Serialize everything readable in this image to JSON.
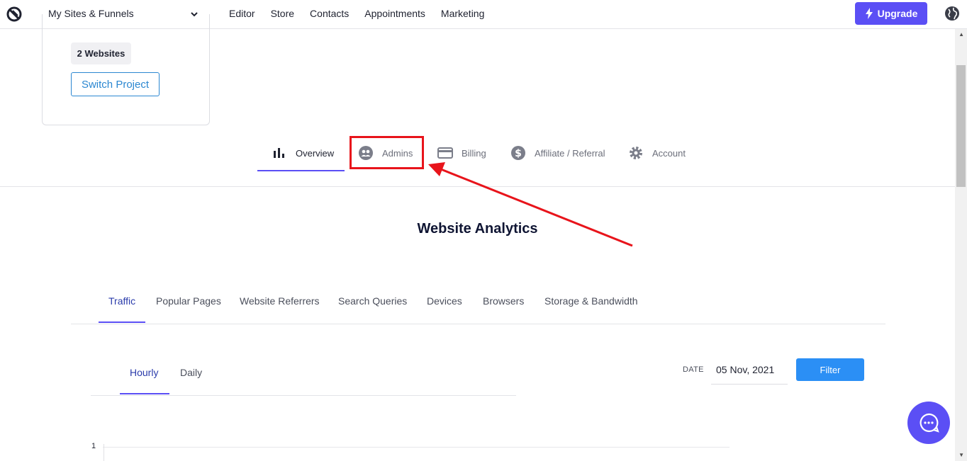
{
  "topnav": {
    "site_select": "My Sites & Funnels",
    "links": [
      "Editor",
      "Store",
      "Contacts",
      "Appointments",
      "Marketing"
    ],
    "upgrade_label": "Upgrade"
  },
  "project_card": {
    "badge": "2 Websites",
    "switch_label": "Switch Project"
  },
  "section_tabs": [
    {
      "label": "Overview",
      "icon": "bar-chart-icon",
      "active": true
    },
    {
      "label": "Admins",
      "icon": "users-icon",
      "active": false
    },
    {
      "label": "Billing",
      "icon": "credit-card-icon",
      "active": false
    },
    {
      "label": "Affiliate / Referral",
      "icon": "dollar-icon",
      "active": false
    },
    {
      "label": "Account",
      "icon": "gear-icon",
      "active": false
    }
  ],
  "analytics": {
    "title": "Website Analytics",
    "tabs": [
      "Traffic",
      "Popular Pages",
      "Website Referrers",
      "Search Queries",
      "Devices",
      "Browsers",
      "Storage & Bandwidth"
    ],
    "active_tab": "Traffic",
    "subtabs": [
      "Hourly",
      "Daily"
    ],
    "active_subtab": "Hourly",
    "date_label": "DATE",
    "date_value": "05 Nov, 2021",
    "filter_label": "Filter",
    "y_axis_first_tick": "1"
  },
  "colors": {
    "accent": "#5b4ff5",
    "link_blue": "#2b87d1",
    "filter_blue": "#2b8ff5",
    "highlight_red": "#e8141b"
  }
}
